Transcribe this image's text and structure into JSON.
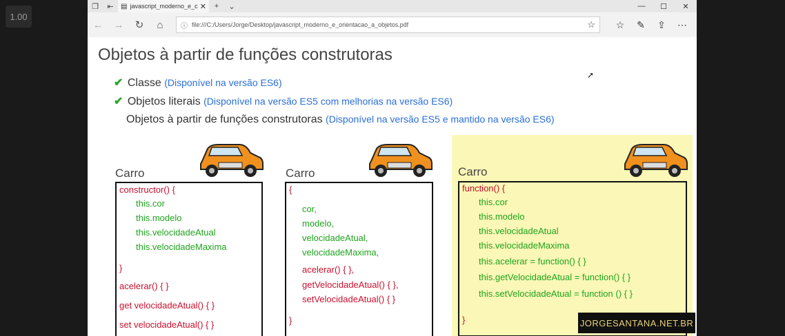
{
  "player": {
    "zoom": "1.00"
  },
  "browser": {
    "tab_title": "javascript_moderno_e_c",
    "url": "file:///C:/Users/Jorge/Desktop/javascript_moderno_e_orientacao_a_objetos.pdf"
  },
  "slide": {
    "title": "Objetos à partir de funções construtoras",
    "bullets": [
      {
        "text": "Classe",
        "note": "(Disponível na versão ES6)"
      },
      {
        "text": "Objetos literais",
        "note": "(Disponível na versão ES5 com melhorias na versão ES6)"
      },
      {
        "text": "Objetos à partir de funções construtoras",
        "note": "(Disponível na versão ES5 e mantido na versão ES6)"
      }
    ],
    "columns": [
      {
        "label": "Carro",
        "lines": [
          "constructor() {",
          "this.cor",
          "this.modelo",
          "this.velocidadeAtual",
          "this.velocidadeMaxima",
          "}",
          "acelerar() {  }",
          "get velocidadeAtual() {  }",
          "set velocidadeAtual() {  }"
        ]
      },
      {
        "label": "Carro",
        "lines": [
          "{",
          "cor,",
          "modelo,",
          "velocidadeAtual,",
          "velocidadeMaxima,",
          "acelerar() {  },",
          "getVelocidadeAtual() {  },",
          "setVelocidadeAtual() {  }",
          "}"
        ]
      },
      {
        "label": "Carro",
        "lines": [
          "function() {",
          "this.cor",
          "this.modelo",
          "this.velocidadeAtual",
          "this.velocidadeMaxima",
          "this.acelerar = function() {  }",
          "this.getVelocidadeAtual = function() {  }",
          "this.setVelocidadeAtual = function () {  }",
          "}"
        ]
      }
    ]
  },
  "watermark": "JORGESANTANA.NET.BR",
  "colors": {
    "code_red": "#c8102e",
    "code_green": "#1ea41e",
    "note_blue": "#2a6fd6",
    "highlight": "#fbf7b6"
  }
}
